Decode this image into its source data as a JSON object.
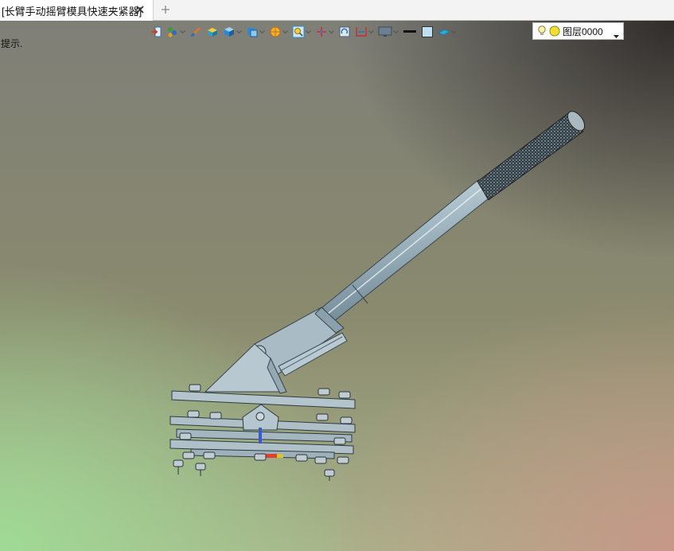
{
  "tab": {
    "title": "[长臂手动摇臂模具快速夹紧器]",
    "close_icon": "close-icon",
    "add_icon": "plus-icon"
  },
  "viewport": {
    "hint": "提示.",
    "colors": {
      "top_right": "#302c2a",
      "bottom_left": "#a0da96",
      "bottom_right": "#c89687",
      "model_metal": "#a9bcc6"
    }
  },
  "toolbar": {
    "buttons": [
      "exit-icon",
      "color-picker-icon",
      "paint-brush-icon",
      "solid-box-icon",
      "box-3d-icon",
      "view-cube-icon",
      "section-view-icon",
      "zoom-view-icon",
      "axis-icon",
      "rotate-icon",
      "measure-icon",
      "display-monitor-icon",
      "line-style-icon",
      "fill-color-icon",
      "plane-icon"
    ],
    "layer": {
      "label": "图层0000",
      "icons": [
        "lightbulb-icon",
        "layer-color-icon",
        "dropdown-arrow-icon"
      ]
    }
  }
}
